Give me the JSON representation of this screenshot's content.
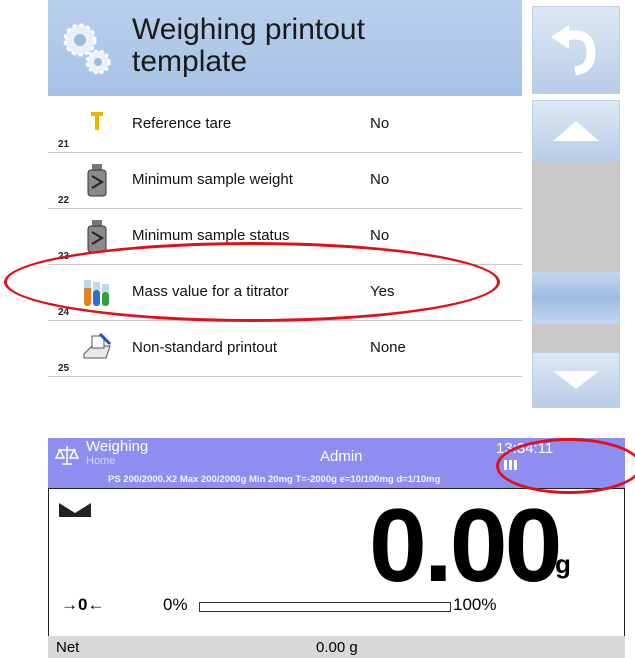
{
  "header": {
    "title_line1": "Weighing printout",
    "title_line2": "template",
    "icon": "gears-icon"
  },
  "menu": {
    "items": [
      {
        "number": "21",
        "label": "Reference tare",
        "value": "No",
        "icon": "tare-icon"
      },
      {
        "number": "22",
        "label": "Minimum sample weight",
        "value": "No",
        "icon": "weight-icon"
      },
      {
        "number": "23",
        "label": "Minimum sample status",
        "value": "No",
        "icon": "weight-icon"
      },
      {
        "number": "24",
        "label": "Mass value for a titrator",
        "value": "Yes",
        "icon": "titrator-icon"
      },
      {
        "number": "25",
        "label": "Non-standard printout",
        "value": "None",
        "icon": "printer-icon"
      }
    ]
  },
  "side_buttons": {
    "back": "back-arrow-icon",
    "up": "chevron-up-icon",
    "down": "chevron-down-icon"
  },
  "status_bar": {
    "mode": "Weighing",
    "sub": "Home",
    "user": "Admin",
    "clock": "13:34:11",
    "spec": "PS 200/2000.X2  Max 200/2000g  Min 20mg  T=-2000g  e=10/100mg  d=1/10mg"
  },
  "display": {
    "reading": "0.00",
    "unit": "g",
    "zero_symbol": "→0←",
    "bargraph_min": "0%",
    "bargraph_max": "100%",
    "bargraph_fill": 0
  },
  "info_bar": {
    "label": "Net",
    "value": "0.00 g"
  },
  "colors": {
    "status_bar": "#8e8ef0",
    "header": "#b9d0ec",
    "highlight": "#e0101a"
  }
}
